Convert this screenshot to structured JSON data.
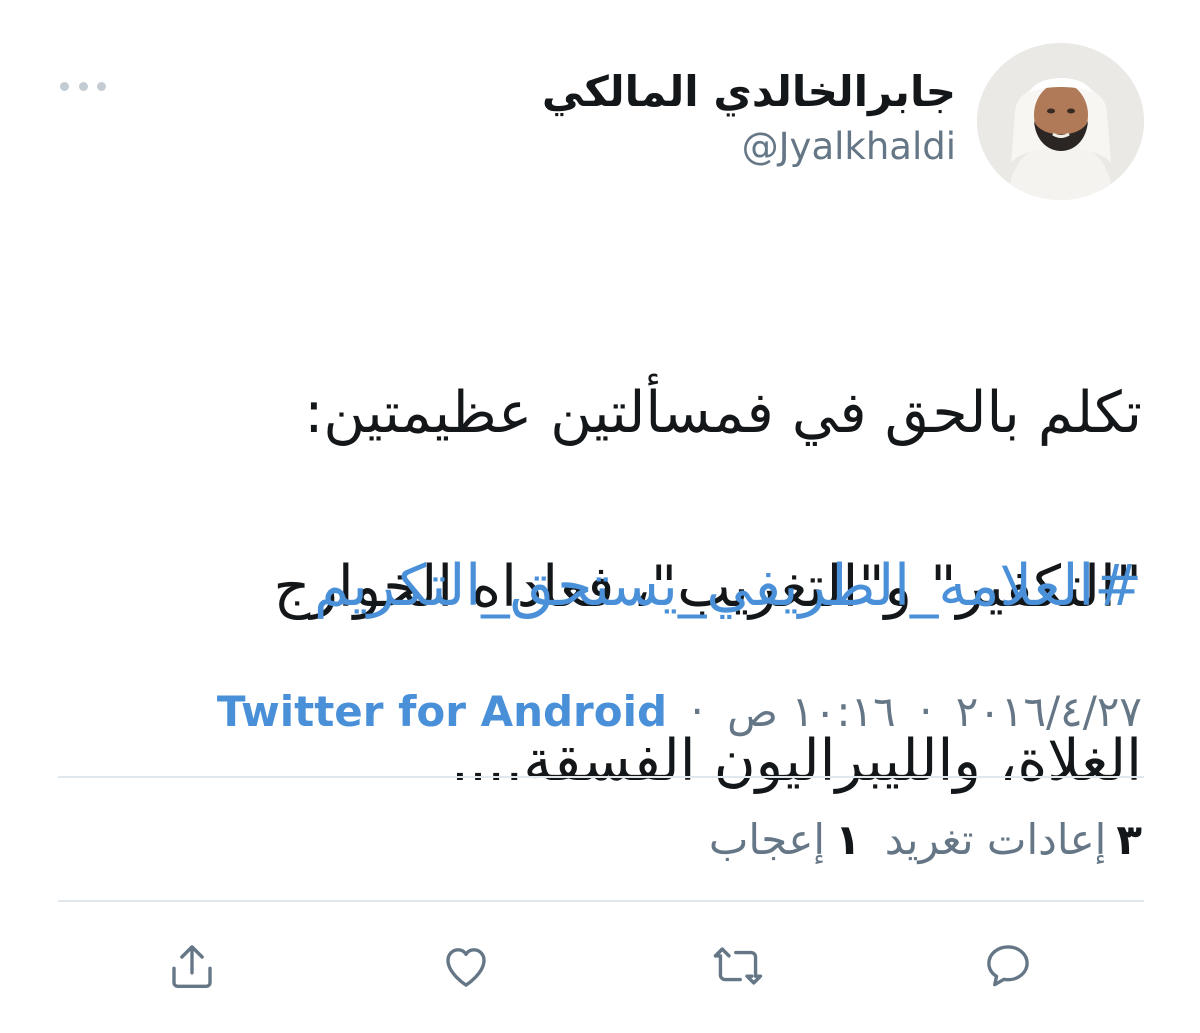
{
  "tweet": {
    "display_name": "جابرالخالدي المالكي",
    "handle": "@Jyalkhaldi",
    "text_lines": [
      "تكلم بالحق في فمسألتين عظيمتين:",
      "\"التكفير\" و\"التغريب\"، فعاداه الخوارج",
      "الغلاة، والليبراليون الفسقة...."
    ],
    "hashtag": "#العلامه_الطريفي_يستحق_التكريم",
    "date": "٢٠١٦/٤/٢٧",
    "time": "١٠:١٦ ص",
    "separator": "·",
    "source": "Twitter for Android"
  },
  "stats": {
    "retweets_count": "٣",
    "retweets_label": "إعادات تغريد",
    "likes_count": "١",
    "likes_label": "إعجاب"
  },
  "actions": {
    "reply_icon": "reply-icon",
    "retweet_icon": "retweet-icon",
    "like_icon": "heart-icon",
    "share_icon": "share-icon"
  },
  "colors": {
    "link": "#4a90d9",
    "icon": "#657786",
    "divider": "#e1e8ed"
  }
}
